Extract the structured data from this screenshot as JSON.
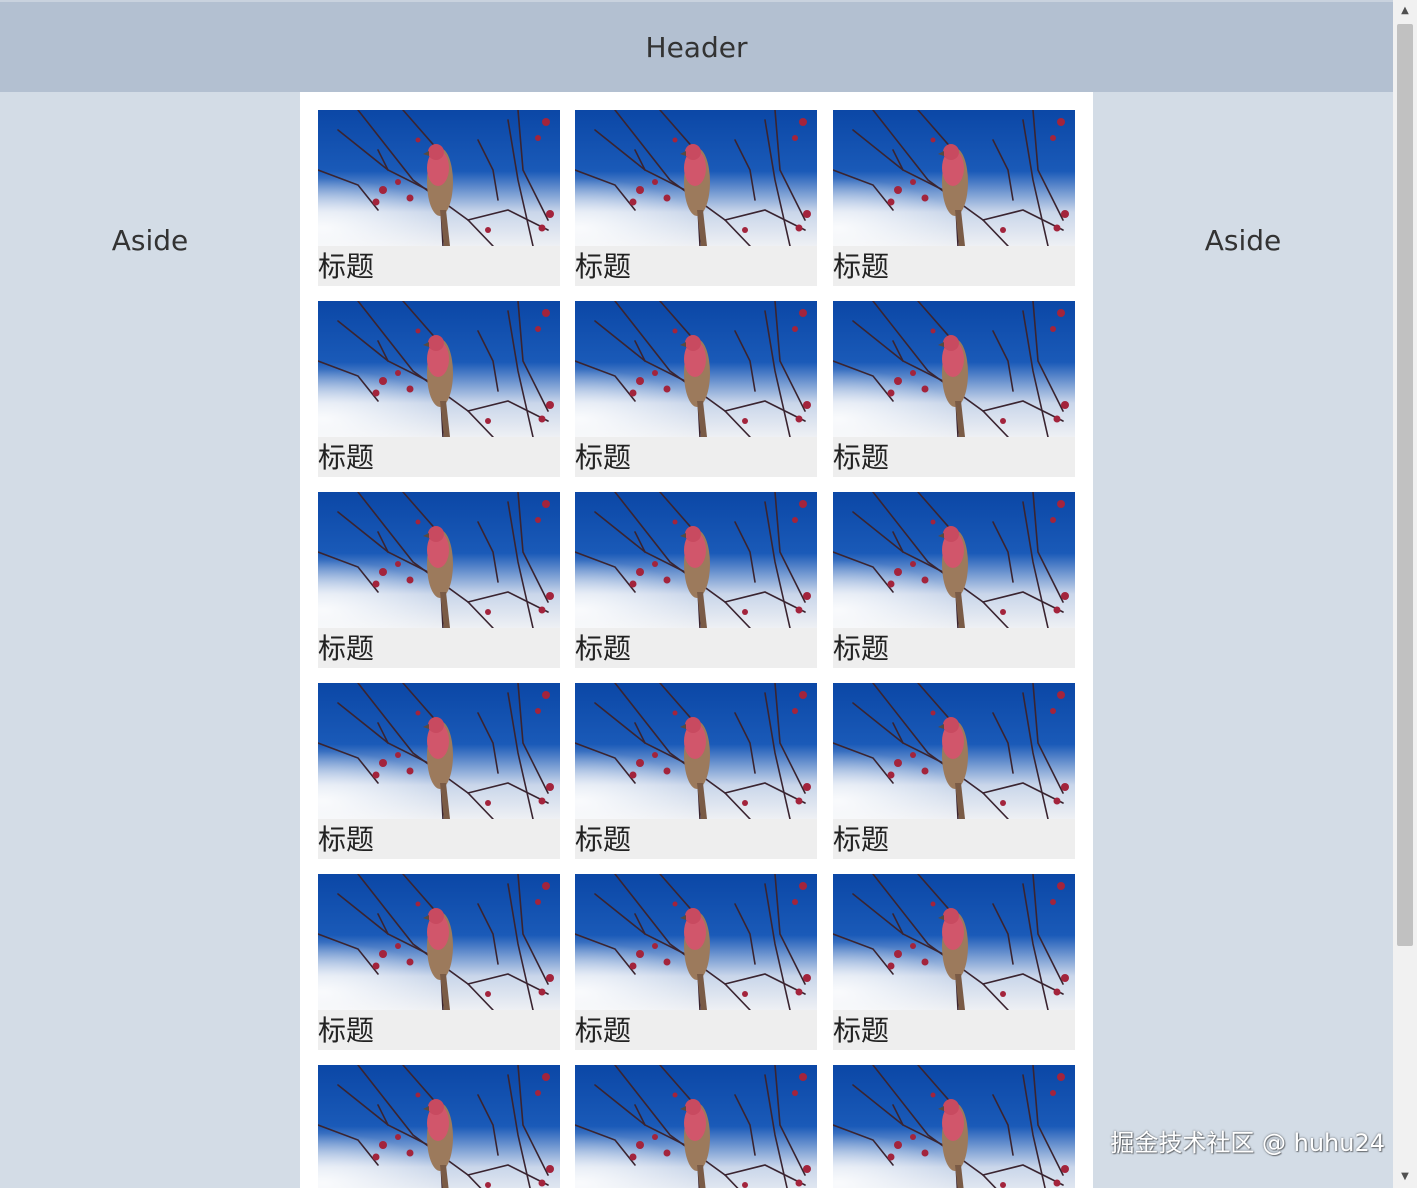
{
  "header": {
    "title": "Header"
  },
  "aside": {
    "left_label": "Aside",
    "right_label": "Aside"
  },
  "grid": {
    "card_title": "标题",
    "image_subject": "bird-on-branch photo",
    "rows_visible": 6,
    "columns": 3
  },
  "watermark": {
    "text": "掘金技术社区 @ huhu24"
  },
  "scrollbar": {
    "up_icon": "triangle-up-icon",
    "down_icon": "triangle-down-icon"
  }
}
